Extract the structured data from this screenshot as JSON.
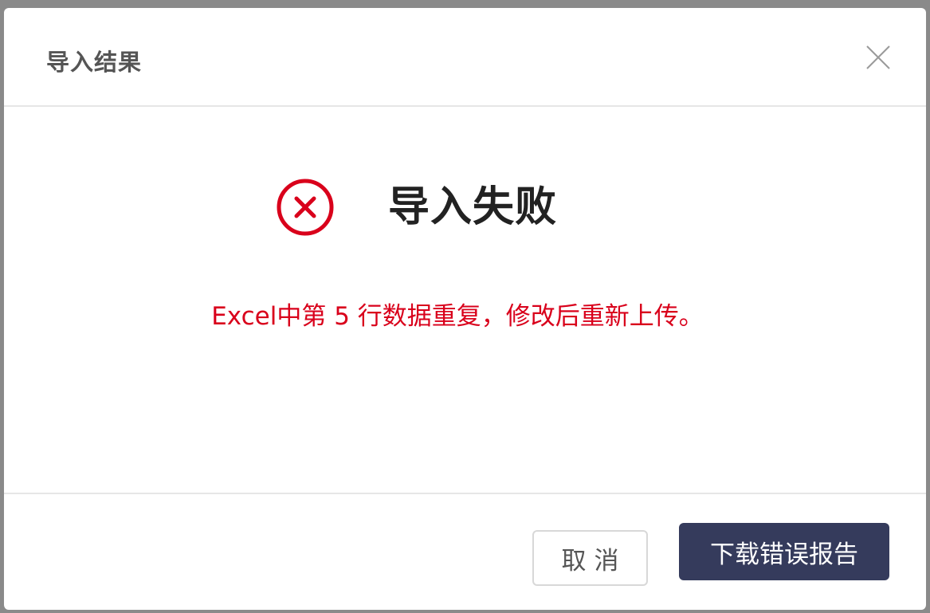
{
  "dialog": {
    "title": "导入结果",
    "close_icon": "close-icon"
  },
  "result": {
    "status_icon": "error-circle-x-icon",
    "status_text": "导入失败",
    "message": "Excel中第 5 行数据重复，修改后重新上传。"
  },
  "footer": {
    "cancel_label": "取消",
    "download_label": "下载错误报告"
  },
  "colors": {
    "error": "#d9001b",
    "primary_button": "#353b5c",
    "overlay": "#8a8a8a"
  }
}
